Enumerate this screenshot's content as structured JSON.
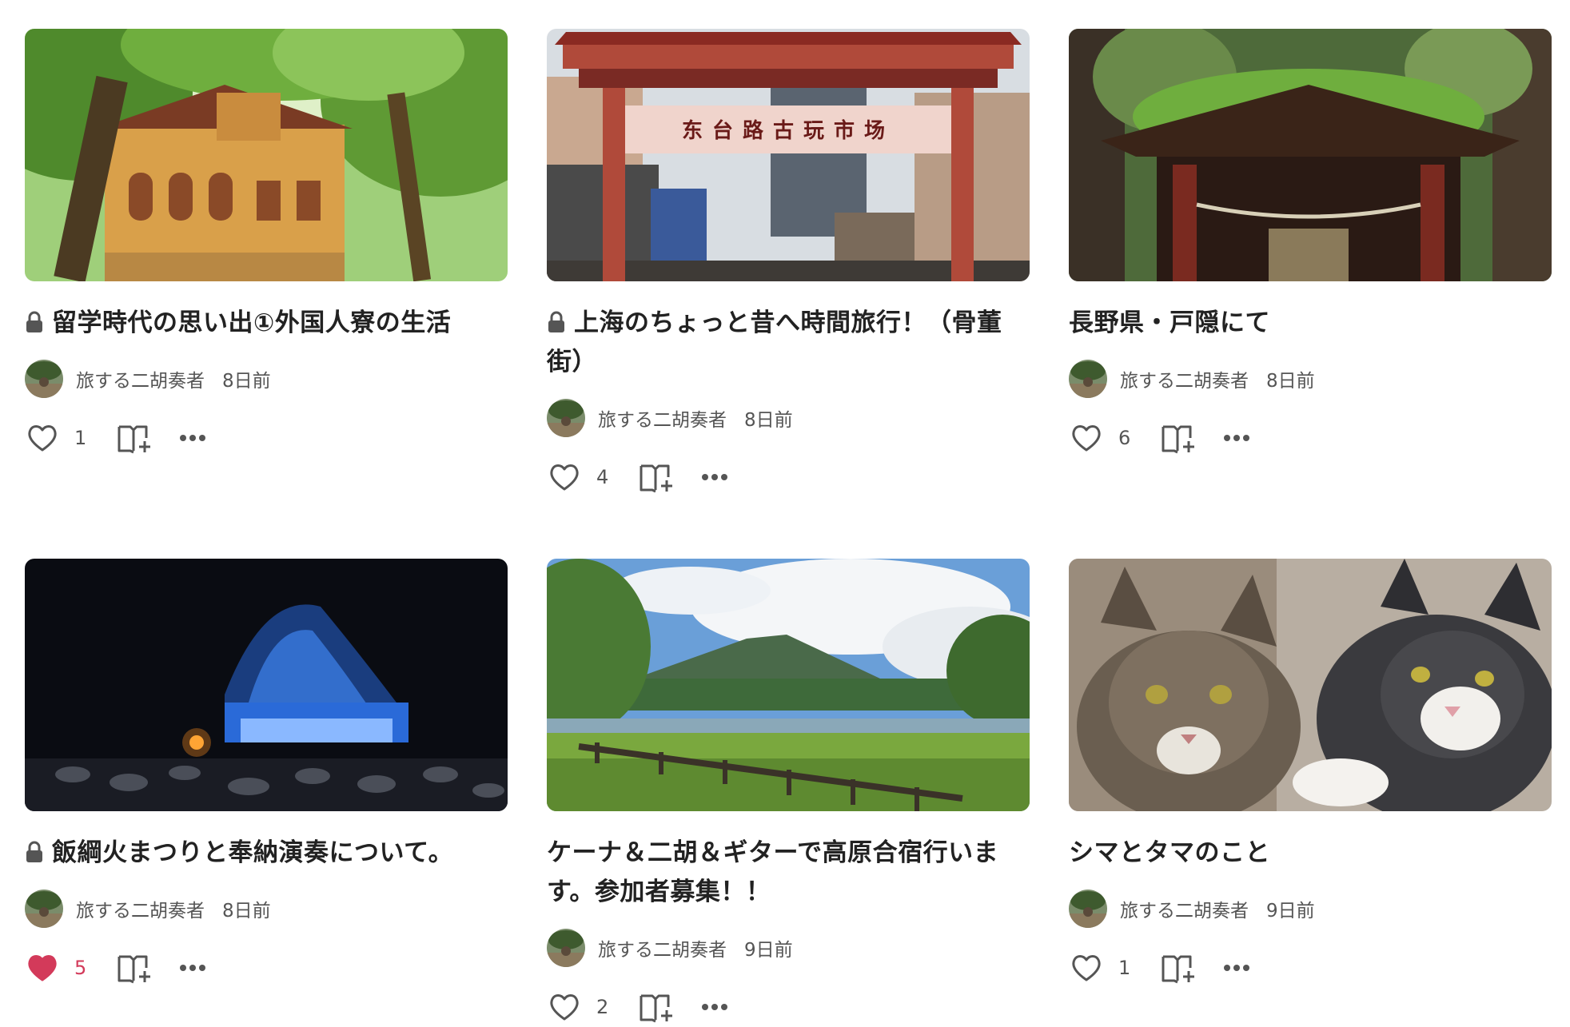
{
  "cards": [
    {
      "title": "留学時代の思い出①外国人寮の生活",
      "locked": true,
      "author": "旅する二胡奏者",
      "date": "8日前",
      "likes": "1",
      "liked": false,
      "image": "yellow-colonial-house-among-trees"
    },
    {
      "title": "上海のちょっと昔へ時間旅行！（骨董街）",
      "locked": true,
      "author": "旅する二胡奏者",
      "date": "8日前",
      "likes": "4",
      "liked": false,
      "image": "antique-market-gate",
      "gate_text": "东台路古玩市场"
    },
    {
      "title": "長野県・戸隠にて",
      "locked": false,
      "author": "旅する二胡奏者",
      "date": "8日前",
      "likes": "6",
      "liked": false,
      "image": "moss-roof-shrine-gate"
    },
    {
      "title": "飯綱火まつりと奉納演奏について。",
      "locked": true,
      "author": "旅する二胡奏者",
      "date": "8日前",
      "likes": "5",
      "liked": true,
      "image": "night-festival-fountain"
    },
    {
      "title": "ケーナ＆二胡＆ギターで高原合宿行います。参加者募集！！",
      "locked": false,
      "author": "旅する二胡奏者",
      "date": "9日前",
      "likes": "2",
      "liked": false,
      "image": "mountain-lake-boardwalk"
    },
    {
      "title": "シマとタマのこと",
      "locked": false,
      "author": "旅する二胡奏者",
      "date": "9日前",
      "likes": "1",
      "liked": false,
      "image": "two-cats"
    }
  ],
  "colors": {
    "liked_heart": "#d33a5a",
    "text_main": "#222222",
    "text_sub": "#555555",
    "icon": "#555555"
  }
}
